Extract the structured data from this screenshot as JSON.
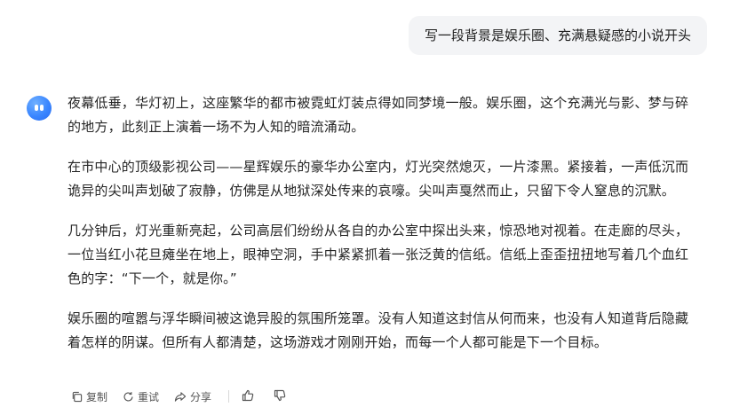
{
  "user_message": "写一段背景是娱乐圈、充满悬疑感的小说开头",
  "assistant": {
    "avatar_icon": "bot-face-icon",
    "accent_color": "#3a86ff",
    "paragraphs": [
      "夜幕低垂，华灯初上，这座繁华的都市被霓虹灯装点得如同梦境一般。娱乐圈，这个充满光与影、梦与碎的地方，此刻正上演着一场不为人知的暗流涌动。",
      "在市中心的顶级影视公司——星辉娱乐的豪华办公室内，灯光突然熄灭，一片漆黑。紧接着，一声低沉而诡异的尖叫声划破了寂静，仿佛是从地狱深处传来的哀嚎。尖叫声戛然而止，只留下令人窒息的沉默。",
      "几分钟后，灯光重新亮起，公司高层们纷纷从各自的办公室中探出头来，惊恐地对视着。在走廊的尽头，一位当红小花旦瘫坐在地上，眼神空洞，手中紧紧抓着一张泛黄的信纸。信纸上歪歪扭扭地写着几个血红色的字：“下一个，就是你。”",
      "娱乐圈的喧嚣与浮华瞬间被这诡异股的氛围所笼罩。没有人知道这封信从何而来，也没有人知道背后隐藏着怎样的阴谋。但所有人都清楚，这场游戏才刚刚开始，而每一个人都可能是下一个目标。"
    ]
  },
  "actions": {
    "copy_label": "复制",
    "retry_label": "重试",
    "share_label": "分享"
  }
}
